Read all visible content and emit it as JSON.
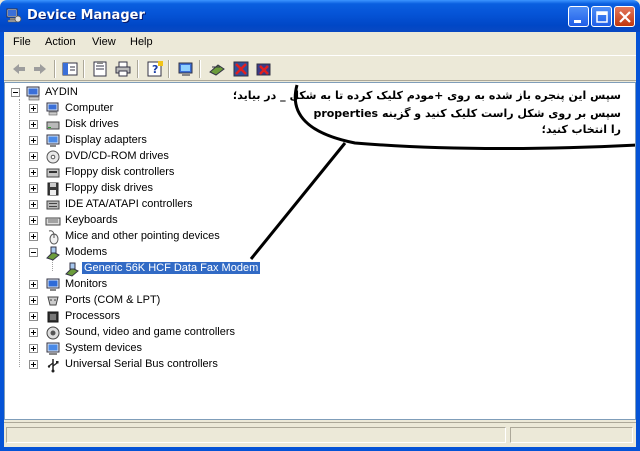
{
  "window": {
    "title": "Device Manager",
    "icon": "device-manager-icon"
  },
  "menu": {
    "file": "File",
    "action": "Action",
    "view": "View",
    "help": "Help"
  },
  "toolbar": {
    "icons": [
      "back-arrow-icon",
      "forward-arrow-icon",
      "show-hide-console-tree-icon",
      "properties-icon",
      "print-icon",
      "help-icon",
      "scan-hardware-icon",
      "update-driver-icon",
      "disable-device-icon",
      "uninstall-device-icon"
    ]
  },
  "tree": {
    "root": "AYDIN",
    "categories": [
      {
        "label": "Computer",
        "icon": "computer-icon"
      },
      {
        "label": "Disk drives",
        "icon": "disk-drive-icon"
      },
      {
        "label": "Display adapters",
        "icon": "display-adapter-icon"
      },
      {
        "label": "DVD/CD-ROM drives",
        "icon": "cdrom-icon"
      },
      {
        "label": "Floppy disk controllers",
        "icon": "floppy-controller-icon"
      },
      {
        "label": "Floppy disk drives",
        "icon": "floppy-drive-icon"
      },
      {
        "label": "IDE ATA/ATAPI controllers",
        "icon": "ide-controller-icon"
      },
      {
        "label": "Keyboards",
        "icon": "keyboard-icon"
      },
      {
        "label": "Mice and other pointing devices",
        "icon": "mouse-icon"
      },
      {
        "label": "Modems",
        "icon": "modem-icon",
        "expanded": true
      },
      {
        "label": "Monitors",
        "icon": "monitor-icon"
      },
      {
        "label": "Ports (COM & LPT)",
        "icon": "port-icon"
      },
      {
        "label": "Processors",
        "icon": "processor-icon"
      },
      {
        "label": "Sound, video and game controllers",
        "icon": "sound-icon"
      },
      {
        "label": "System devices",
        "icon": "system-device-icon"
      },
      {
        "label": "Universal Serial Bus controllers",
        "icon": "usb-icon"
      }
    ],
    "selected_child": "Generic 56K HCF Data Fax Modem"
  },
  "annotation": {
    "line1": "سپس این پنجره باز شده به روی +مودم کلیک کرده تا به شکل _ در بیاید؛",
    "line2": "سپس بر روی شکل راست کلیک کنید و گزینه properties",
    "line3": "را انتخاب کنید؛"
  },
  "colors": {
    "titlebar": "#0553d6",
    "selection": "#316ac5"
  }
}
